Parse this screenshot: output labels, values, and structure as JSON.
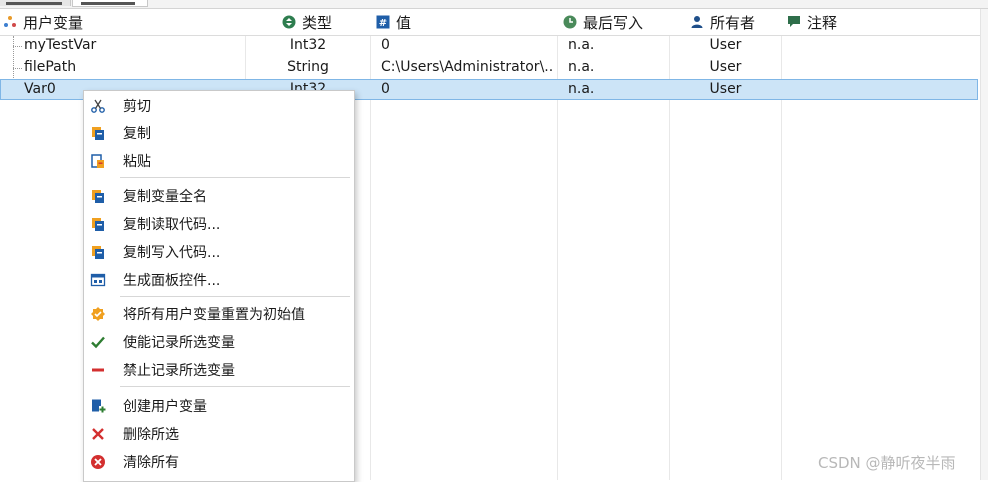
{
  "columns": {
    "name": "用户变量",
    "type": "类型",
    "value": "值",
    "last_write": "最后写入",
    "owner": "所有者",
    "comment": "注释"
  },
  "rows": [
    {
      "name": "myTestVar",
      "type": "Int32",
      "value": "0",
      "last_write": "n.a.",
      "owner": "User",
      "comment": ""
    },
    {
      "name": "filePath",
      "type": "String",
      "value": "C:\\Users\\Administrator\\...",
      "last_write": "n.a.",
      "owner": "User",
      "comment": ""
    },
    {
      "name": "Var0",
      "type": "Int32",
      "value": "0",
      "last_write": "n.a.",
      "owner": "User",
      "comment": ""
    }
  ],
  "context_menu": {
    "items": [
      {
        "label": "剪切",
        "icon": "scissors-icon"
      },
      {
        "label": "复制",
        "icon": "copy-icon"
      },
      {
        "label": "粘贴",
        "icon": "paste-icon"
      },
      {
        "label": "复制变量全名",
        "icon": "copy-icon"
      },
      {
        "label": "复制读取代码...",
        "icon": "copy-icon"
      },
      {
        "label": "复制写入代码...",
        "icon": "copy-icon"
      },
      {
        "label": "生成面板控件...",
        "icon": "panel-icon"
      },
      {
        "label": "将所有用户变量重置为初始值",
        "icon": "reset-badge-icon"
      },
      {
        "label": "使能记录所选变量",
        "icon": "checkmark-icon"
      },
      {
        "label": "禁止记录所选变量",
        "icon": "minus-icon"
      },
      {
        "label": "创建用户变量",
        "icon": "add-document-icon"
      },
      {
        "label": "删除所选",
        "icon": "delete-x-icon"
      },
      {
        "label": "清除所有",
        "icon": "clear-all-icon"
      }
    ]
  },
  "watermark": "CSDN @静听夜半雨",
  "colors": {
    "selection_bg": "#cce4f7",
    "selection_border": "#7fb6e6",
    "accent_blue": "#1f5ea8",
    "check_green": "#2e7d32",
    "red": "#d32f2f",
    "orange": "#f0a020"
  }
}
